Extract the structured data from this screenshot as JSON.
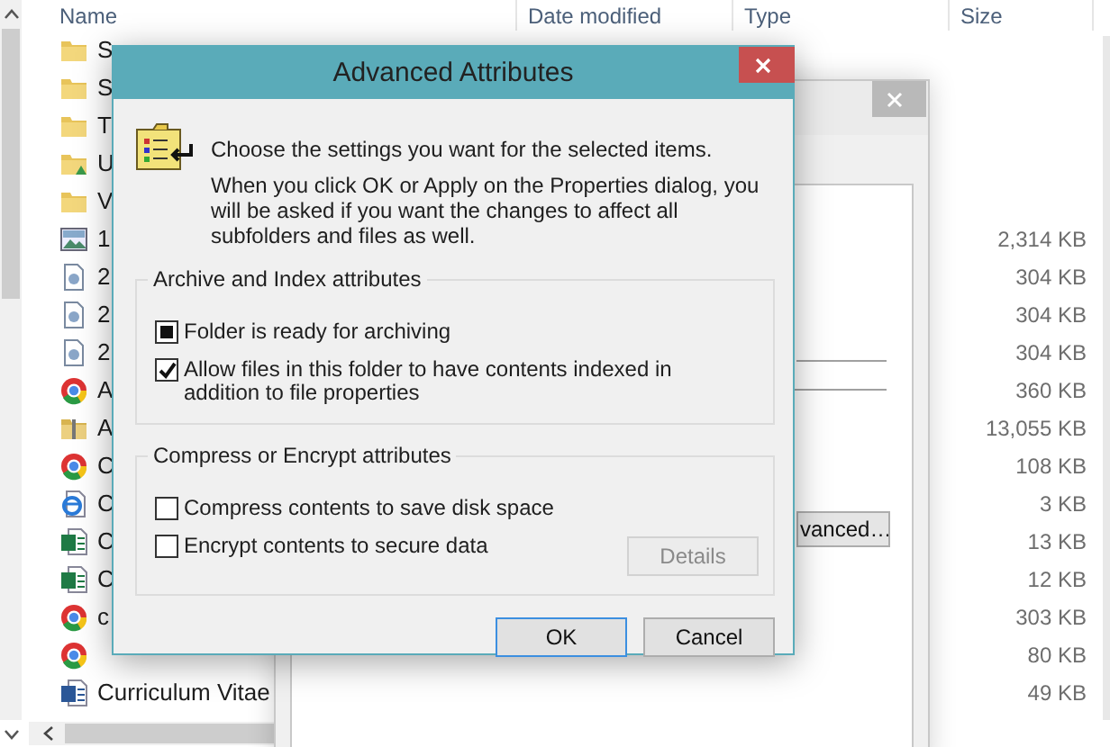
{
  "explorer": {
    "columns": [
      "Name",
      "Date modified",
      "Type",
      "Size"
    ],
    "rows": [
      {
        "kind": "folder",
        "name": "S"
      },
      {
        "kind": "folder",
        "name": "S"
      },
      {
        "kind": "folder",
        "name": "T"
      },
      {
        "kind": "shared-folder",
        "name": "U"
      },
      {
        "kind": "folder",
        "name": "V"
      },
      {
        "kind": "image",
        "name": "1",
        "size": "2,314 KB"
      },
      {
        "kind": "file",
        "name": "2",
        "size": "304 KB"
      },
      {
        "kind": "file",
        "name": "2",
        "size": "304 KB"
      },
      {
        "kind": "file",
        "name": "2",
        "size": "304 KB"
      },
      {
        "kind": "browser",
        "name": "A",
        "size": "360 KB"
      },
      {
        "kind": "archive",
        "name": "A",
        "size": "13,055 KB"
      },
      {
        "kind": "browser",
        "name": "C",
        "size": "108 KB"
      },
      {
        "kind": "web",
        "name": "C",
        "size": "3 KB"
      },
      {
        "kind": "sheet",
        "name": "C",
        "size": "13 KB"
      },
      {
        "kind": "sheet",
        "name": "C",
        "size": "12 KB"
      },
      {
        "kind": "browser",
        "name": "c",
        "size": "303 KB"
      },
      {
        "kind": "browser",
        "size": "80 KB"
      },
      {
        "kind": "doc",
        "name": "Curriculum Vitae",
        "size": "49 KB"
      }
    ]
  },
  "properties_window": {
    "button": "vanced…"
  },
  "dialog": {
    "title": "Advanced Attributes",
    "intro": "Choose the settings you want for the selected items.",
    "note": "When you click OK or Apply on the Properties dialog, you will be asked if you want the changes to affect all subfolders and files as well.",
    "groups": [
      {
        "title": "Archive and Index attributes",
        "options": [
          {
            "label": "Folder is ready for archiving",
            "checked": false,
            "indeterminate": true
          },
          {
            "label": "Allow files in this folder to have contents indexed in addition to file properties",
            "checked": true,
            "indeterminate": false
          }
        ]
      },
      {
        "title": "Compress or Encrypt attributes",
        "options": [
          {
            "label": "Compress contents to save disk space",
            "checked": false,
            "indeterminate": false
          },
          {
            "label": "Encrypt contents to secure data",
            "checked": false,
            "indeterminate": false
          }
        ],
        "button": {
          "label": "Details",
          "disabled": true
        }
      }
    ],
    "buttons": [
      {
        "label": "OK",
        "focused": true
      },
      {
        "label": "Cancel",
        "focused": false
      }
    ]
  }
}
